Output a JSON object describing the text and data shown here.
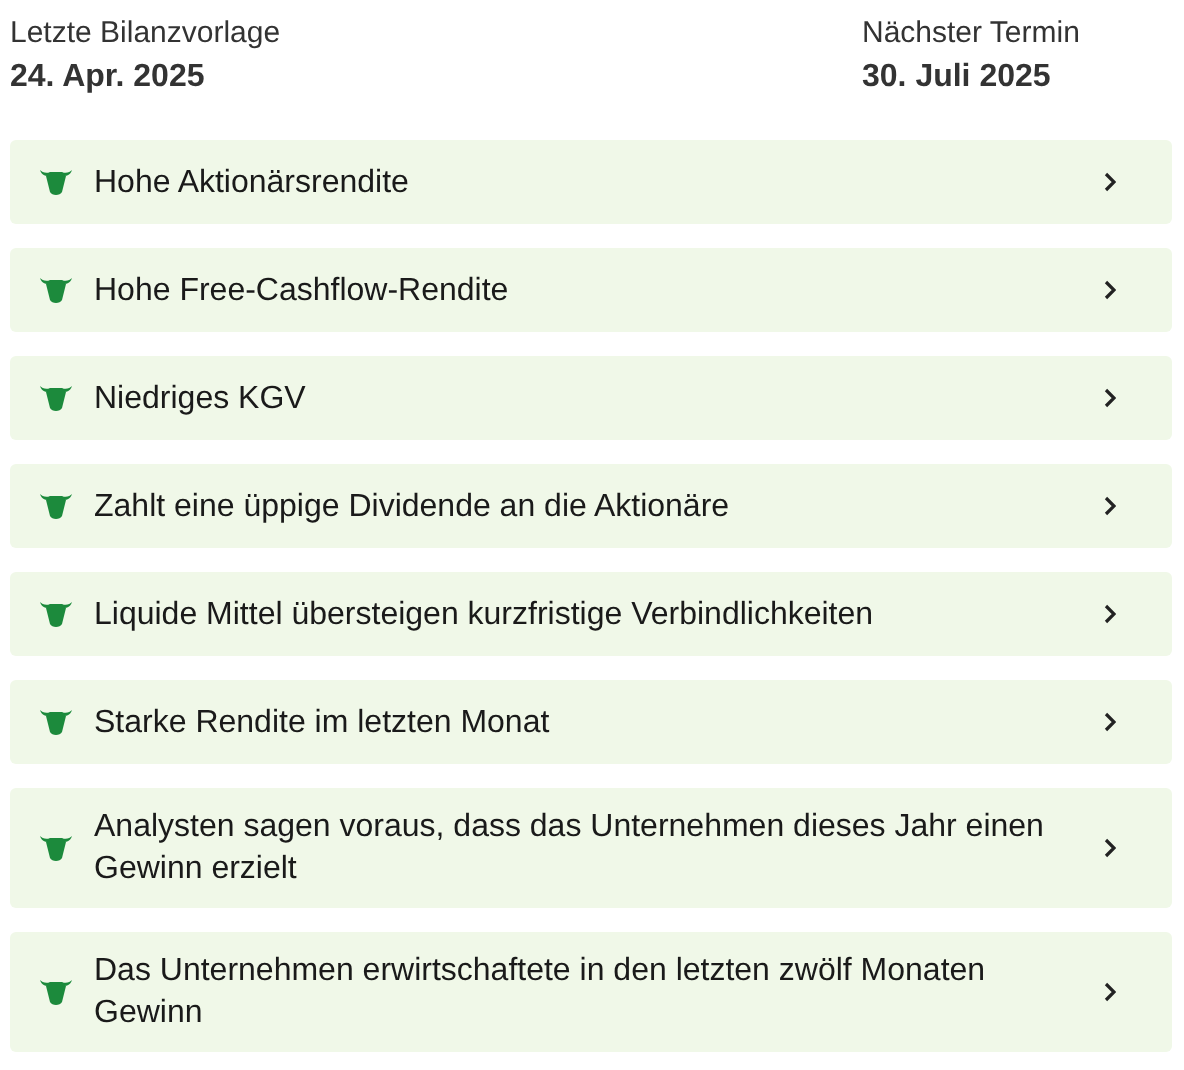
{
  "last_report": {
    "label": "Letzte Bilanzvorlage",
    "date": "24. Apr. 2025"
  },
  "next_date": {
    "label": "Nächster Termin",
    "date": "30. Juli 2025"
  },
  "items": [
    {
      "label": "Hohe Aktionärsrendite"
    },
    {
      "label": "Hohe Free-Cashflow-Rendite"
    },
    {
      "label": "Niedriges KGV"
    },
    {
      "label": "Zahlt eine üppige Dividende an die Aktionäre"
    },
    {
      "label": "Liquide Mittel übersteigen kurzfristige Verbindlichkeiten"
    },
    {
      "label": "Starke Rendite im letzten Monat"
    },
    {
      "label": "Analysten sagen voraus, dass das Unternehmen dieses Jahr einen Gewinn erzielt"
    },
    {
      "label": "Das Unternehmen erwirtschaftete in den letzten zwölf Monaten Gewinn"
    }
  ]
}
